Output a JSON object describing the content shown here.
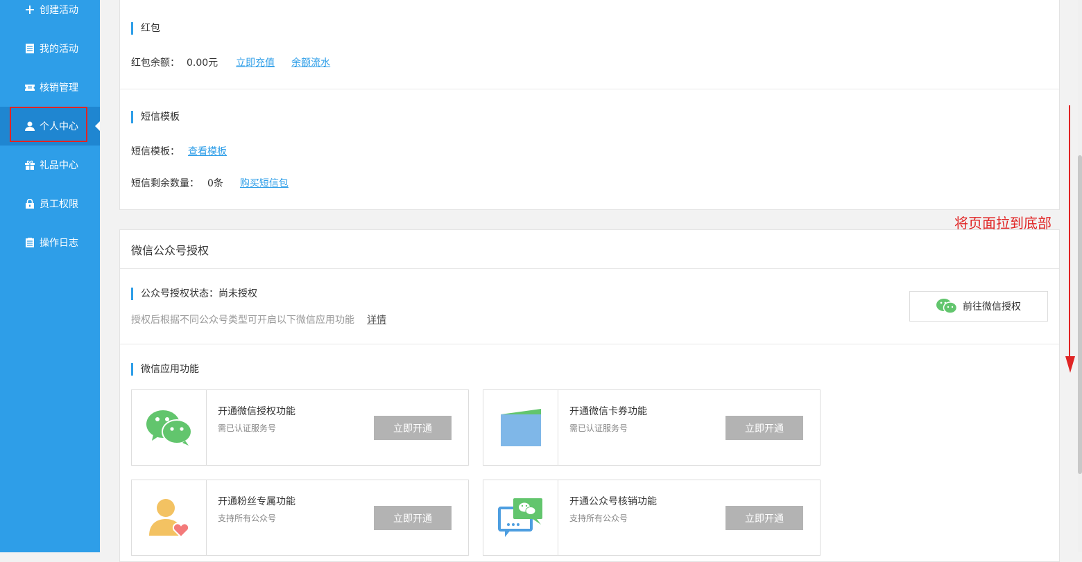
{
  "sidebar": {
    "items": [
      {
        "label": "创建活动",
        "icon": "plus-icon"
      },
      {
        "label": "我的活动",
        "icon": "document-icon"
      },
      {
        "label": "核销管理",
        "icon": "ticket-icon"
      },
      {
        "label": "个人中心",
        "icon": "user-icon",
        "active": true
      },
      {
        "label": "礼品中心",
        "icon": "gift-icon"
      },
      {
        "label": "员工权限",
        "icon": "lock-icon"
      },
      {
        "label": "操作日志",
        "icon": "log-icon"
      }
    ]
  },
  "redpacket": {
    "title": "红包",
    "balance_label": "红包余额：",
    "balance_value": "0.00元",
    "recharge_link": "立即充值",
    "flow_link": "余额流水"
  },
  "sms": {
    "title": "短信模板",
    "template_label": "短信模板：",
    "view_link": "查看模板",
    "remaining_label": "短信剩余数量：",
    "remaining_value": "0条",
    "buy_link": "购买短信包"
  },
  "annotation": {
    "note": "将页面拉到底部"
  },
  "wechat": {
    "header": "微信公众号授权",
    "status": "公众号授权状态：尚未授权",
    "desc": "授权后根据不同公众号类型可开启以下微信应用功能",
    "detail_link": "详情",
    "auth_button": "前往微信授权",
    "features_title": "微信应用功能",
    "cards": [
      {
        "title": "开通微信授权功能",
        "sub": "需已认证服务号",
        "btn": "立即开通",
        "icon": "wechat-chat-icon"
      },
      {
        "title": "开通微信卡券功能",
        "sub": "需已认证服务号",
        "btn": "立即开通",
        "icon": "wallet-icon"
      },
      {
        "title": "开通粉丝专属功能",
        "sub": "支持所有公众号",
        "btn": "立即开通",
        "icon": "fan-heart-icon"
      },
      {
        "title": "开通公众号核销功能",
        "sub": "支持所有公众号",
        "btn": "立即开通",
        "icon": "message-verify-icon"
      }
    ]
  },
  "colors": {
    "sidebar": "#2e9ee8",
    "active": "#1f86d1",
    "link": "#2e9ee8",
    "wechat_green": "#62c56d",
    "annotation_red": "#e02424",
    "button_gray": "#b3b3b3"
  }
}
